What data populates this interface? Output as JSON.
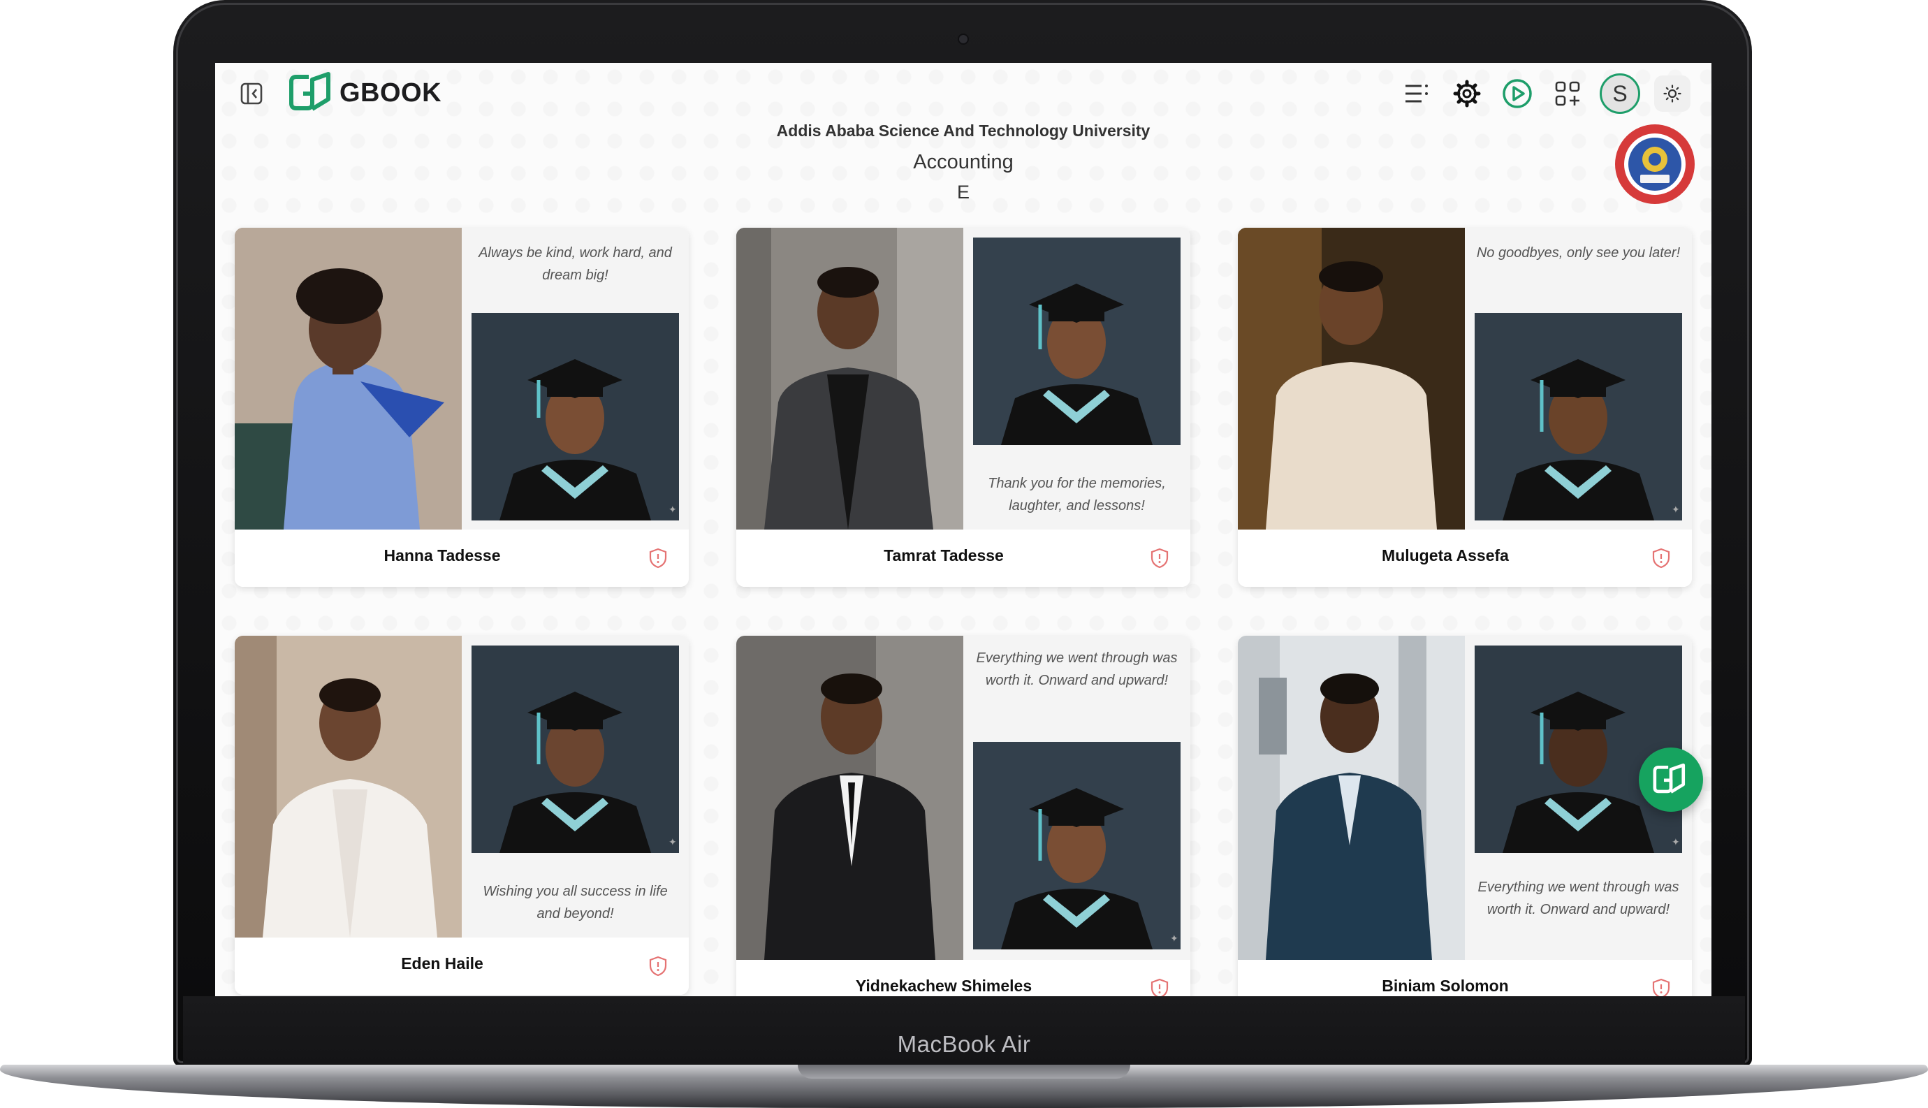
{
  "device": {
    "label": "MacBook Air"
  },
  "header": {
    "logo_text": "GBOOK",
    "avatar_initial": "S"
  },
  "page": {
    "university": "Addis Ababa Science And Technology University",
    "department": "Accounting",
    "section": "E"
  },
  "colors": {
    "brand_green": "#1e9e6a",
    "fab_green": "#16a35f",
    "shield_red": "#e57373"
  },
  "icons": [
    "sidebar-toggle-icon",
    "menu-icon",
    "gear-icon",
    "play-icon",
    "apps-icon",
    "sun-icon",
    "shield-icon",
    "gbook-logo-icon"
  ],
  "students": [
    {
      "name": "Hanna Tadesse",
      "quote": "Always be kind, work hard, and dream big!",
      "quote_position": "top"
    },
    {
      "name": "Tamrat Tadesse",
      "quote": "Thank you for the memories, laughter, and lessons!",
      "quote_position": "bottom"
    },
    {
      "name": "Mulugeta Assefa",
      "quote": "No goodbyes, only see you later!",
      "quote_position": "top"
    },
    {
      "name": "Eden Haile",
      "quote": "Wishing you all success in life and beyond!",
      "quote_position": "bottom"
    },
    {
      "name": "Yidnekachew Shimeles",
      "quote": "Everything we went through was worth it. Onward and upward!",
      "quote_position": "top"
    },
    {
      "name": "Biniam Solomon",
      "quote": "Everything we went through was worth it. Onward and upward!",
      "quote_position": "bottom"
    }
  ]
}
